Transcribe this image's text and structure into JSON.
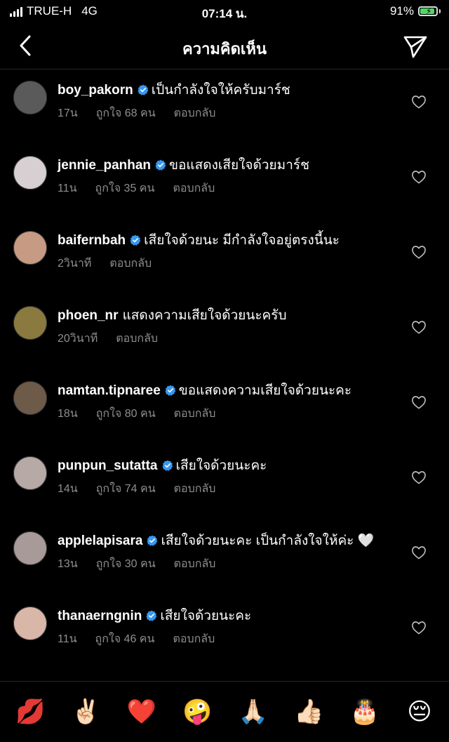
{
  "status_bar": {
    "carrier": "TRUE-H",
    "network": "4G",
    "time": "07:14 น.",
    "battery_percent": "91%",
    "battery_level": 0.91
  },
  "header": {
    "title": "ความคิดเห็น",
    "back_icon": "chevron-left-icon",
    "share_icon": "paper-plane-icon"
  },
  "comments": [
    {
      "username": "boy_pakorn",
      "verified": true,
      "text": "เป็นกำลังใจให้ครับมาร์ช",
      "time": "17น",
      "likes": "ถูกใจ 68 คน",
      "reply": "ตอบกลับ",
      "avatar_color": "#5a5a5a"
    },
    {
      "username": "jennie_panhan",
      "verified": true,
      "text": "ขอแสดงเสียใจด้วยมาร์ช",
      "time": "11น",
      "likes": "ถูกใจ 35 คน",
      "reply": "ตอบกลับ",
      "avatar_color": "#d8cfd2"
    },
    {
      "username": "baifernbah",
      "verified": true,
      "text": "เสียใจด้วยนะ มีกำลังใจอยู่ตรงนี้นะ",
      "time": "2วินาที",
      "likes": "",
      "reply": "ตอบกลับ",
      "avatar_color": "#c79a84"
    },
    {
      "username": "phoen_nr",
      "verified": false,
      "text": "แสดงความเสียใจด้วยนะครับ",
      "time": "20วินาที",
      "likes": "",
      "reply": "ตอบกลับ",
      "avatar_color": "#8a7a40"
    },
    {
      "username": "namtan.tipnaree",
      "verified": true,
      "text": "ขอแสดงความเสียใจด้วยนะคะ",
      "time": "18น",
      "likes": "ถูกใจ 80 คน",
      "reply": "ตอบกลับ",
      "avatar_color": "#6e5a48"
    },
    {
      "username": "punpun_sutatta",
      "verified": true,
      "text": "เสียใจด้วยนะคะ",
      "time": "14น",
      "likes": "ถูกใจ 74 คน",
      "reply": "ตอบกลับ",
      "avatar_color": "#b7a9a6"
    },
    {
      "username": "applelapisara",
      "verified": true,
      "text": "เสียใจด้วยนะคะ เป็นกำลังใจให้ค่ะ 🤍",
      "time": "13น",
      "likes": "ถูกใจ 30 คน",
      "reply": "ตอบกลับ",
      "avatar_color": "#a89a98"
    },
    {
      "username": "thanaerngnin",
      "verified": true,
      "text": "เสียใจด้วยนะคะ",
      "time": "11น",
      "likes": "ถูกใจ 46 คน",
      "reply": "ตอบกลับ",
      "avatar_color": "#d9b7a8"
    }
  ],
  "emoji_bar": [
    "💋",
    "✌🏻",
    "❤️",
    "🤪",
    "🙏🏻",
    "👍🏻",
    "🎂",
    "😔"
  ],
  "colors": {
    "background": "#000000",
    "meta_text": "#8e8e8e",
    "verified_blue": "#3897f0",
    "divider": "#262626"
  }
}
